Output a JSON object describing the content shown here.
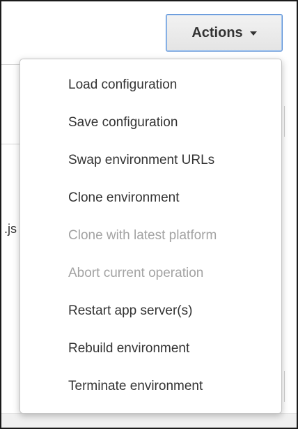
{
  "toolbar": {
    "actions_label": "Actions",
    "caret_icon": "caret-down"
  },
  "background": {
    "partial_text": ".js"
  },
  "menu": {
    "items": [
      {
        "label": "Load configuration",
        "enabled": true
      },
      {
        "label": "Save configuration",
        "enabled": true
      },
      {
        "label": "Swap environment URLs",
        "enabled": true
      },
      {
        "label": "Clone environment",
        "enabled": true
      },
      {
        "label": "Clone with latest platform",
        "enabled": false
      },
      {
        "label": "Abort current operation",
        "enabled": false
      },
      {
        "label": "Restart app server(s)",
        "enabled": true
      },
      {
        "label": "Rebuild environment",
        "enabled": true
      },
      {
        "label": "Terminate environment",
        "enabled": true
      }
    ]
  },
  "colors": {
    "text": "#333333",
    "disabled_text": "#a3a3a3",
    "button_focus_border": "#5a8fd6"
  }
}
